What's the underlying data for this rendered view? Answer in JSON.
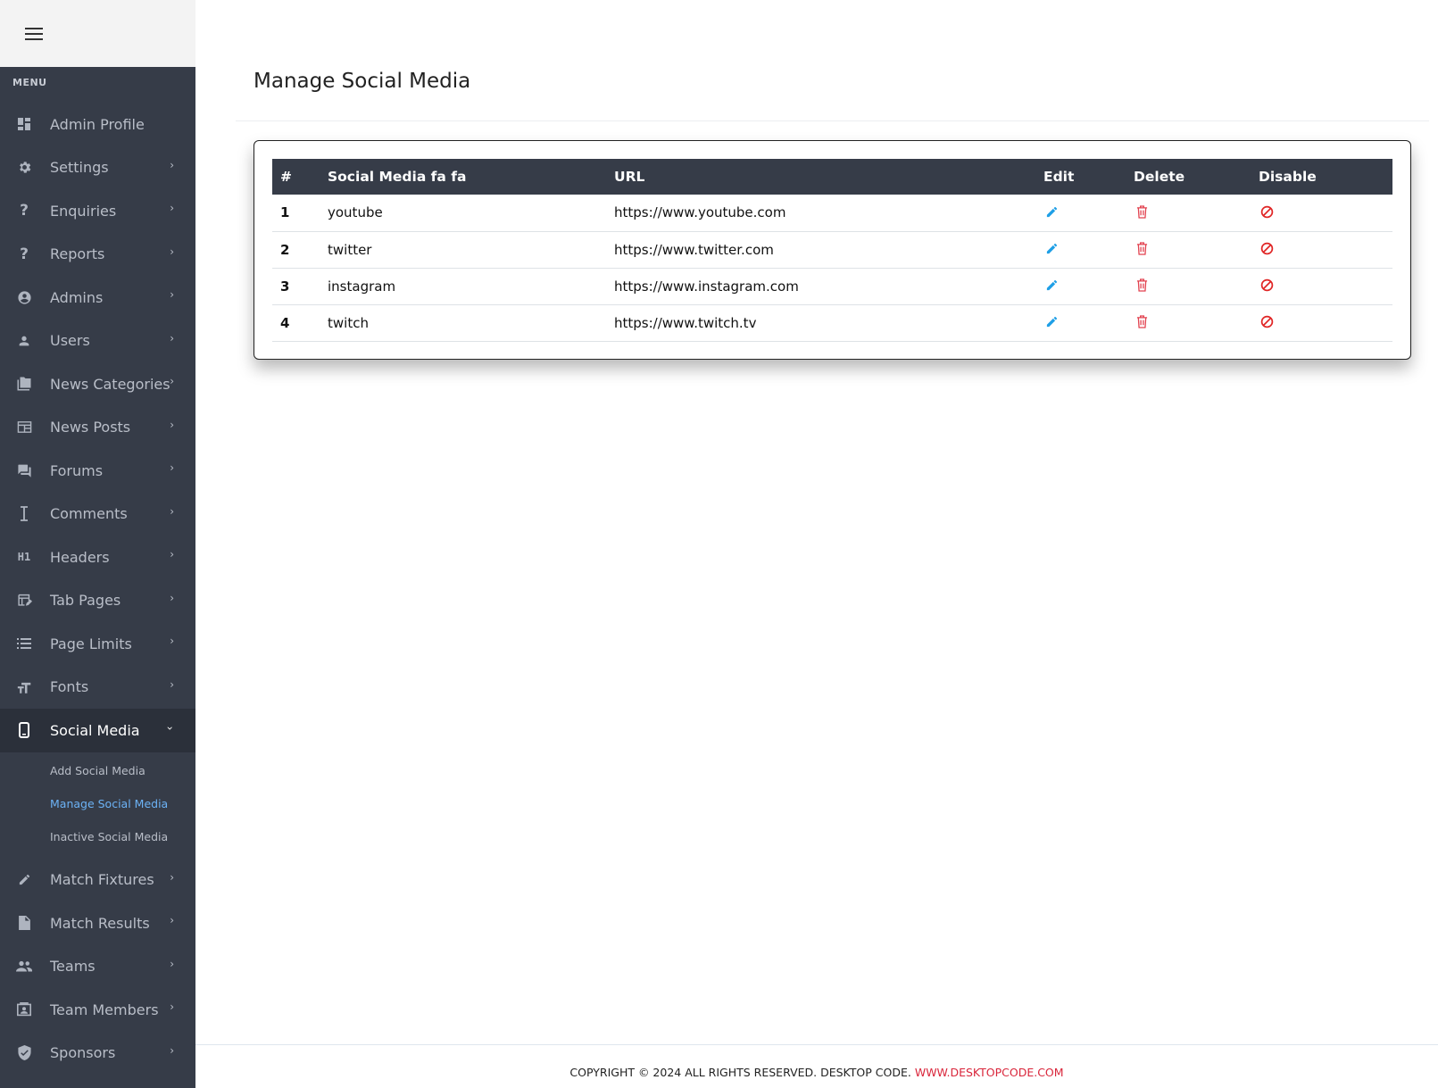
{
  "sidebar": {
    "menu_label": "MENU",
    "items": [
      {
        "label": "Admin Profile",
        "icon": "dashboard-icon",
        "chevron": false
      },
      {
        "label": "Settings",
        "icon": "gear-icon",
        "chevron": true
      },
      {
        "label": "Enquiries",
        "icon": "question-icon",
        "chevron": true
      },
      {
        "label": "Reports",
        "icon": "question-icon",
        "chevron": true
      },
      {
        "label": "Admins",
        "icon": "account-circle-icon",
        "chevron": true
      },
      {
        "label": "Users",
        "icon": "person-icon",
        "chevron": true
      },
      {
        "label": "News Categories",
        "icon": "folder-icon",
        "chevron": true
      },
      {
        "label": "News Posts",
        "icon": "newspaper-icon",
        "chevron": true
      },
      {
        "label": "Forums",
        "icon": "forum-icon",
        "chevron": true
      },
      {
        "label": "Comments",
        "icon": "text-cursor-icon",
        "chevron": true
      },
      {
        "label": "Headers",
        "icon": "h1-icon",
        "chevron": true
      },
      {
        "label": "Tab Pages",
        "icon": "tab-page-icon",
        "chevron": true
      },
      {
        "label": "Page Limits",
        "icon": "list-icon",
        "chevron": true
      },
      {
        "label": "Fonts",
        "icon": "font-size-icon",
        "chevron": true
      },
      {
        "label": "Social Media",
        "icon": "phone-icon",
        "chevron": true,
        "active": true
      },
      {
        "label": "Match Fixtures",
        "icon": "pencil-icon",
        "chevron": true
      },
      {
        "label": "Match Results",
        "icon": "document-icon",
        "chevron": true
      },
      {
        "label": "Teams",
        "icon": "group-icon",
        "chevron": true
      },
      {
        "label": "Team Members",
        "icon": "contact-frame-icon",
        "chevron": true
      },
      {
        "label": "Sponsors",
        "icon": "verified-shield-icon",
        "chevron": true
      }
    ],
    "social_submenu": [
      {
        "label": "Add Social Media"
      },
      {
        "label": "Manage Social Media",
        "current": true
      },
      {
        "label": "Inactive Social Media"
      }
    ]
  },
  "main": {
    "title": "Manage Social Media",
    "table": {
      "headers": [
        "#",
        "Social Media fa fa",
        "URL",
        "Edit",
        "Delete",
        "Disable"
      ],
      "rows": [
        {
          "num": "1",
          "name": "youtube",
          "url": "https://www.youtube.com"
        },
        {
          "num": "2",
          "name": "twitter",
          "url": "https://www.twitter.com"
        },
        {
          "num": "3",
          "name": "instagram",
          "url": "https://www.instagram.com"
        },
        {
          "num": "4",
          "name": "twitch",
          "url": "https://www.twitch.tv"
        }
      ]
    }
  },
  "footer": {
    "text": "COPYRIGHT © 2024 ALL RIGHTS RESERVED. DESKTOP CODE.",
    "link": "WWW.DESKTOPCODE.COM"
  },
  "colors": {
    "sidebar_bg": "#363c48",
    "edit_icon": "#1e9fe6",
    "delete_icon": "#e2424f",
    "disable_icon": "#e02525",
    "footer_link": "#d9263b",
    "submenu_current": "#6cb2f5"
  }
}
